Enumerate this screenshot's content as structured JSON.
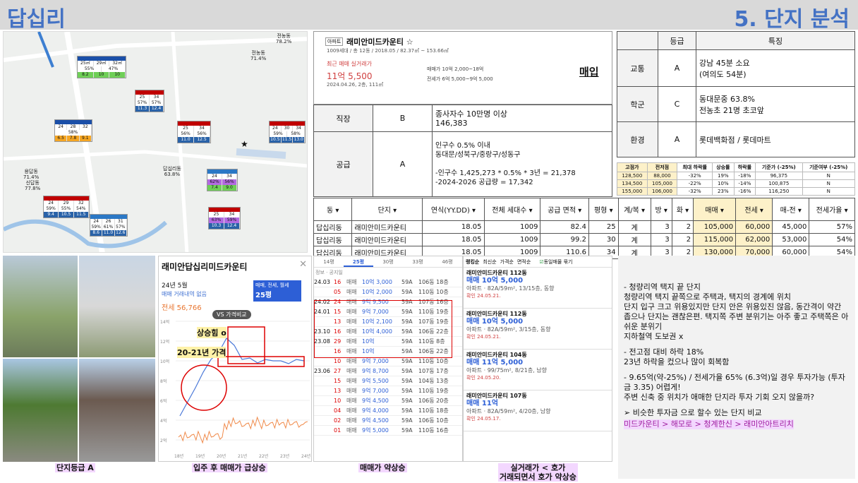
{
  "header": {
    "title_left": "답십리",
    "title_right": "5. 단지 분석"
  },
  "map": {
    "labels": [
      {
        "text": "전농동\n78.2%"
      },
      {
        "text": "전농동\n71.4%"
      },
      {
        "text": "용답동\n71.4%"
      },
      {
        "text": "신답동\n77.8%"
      },
      {
        "text": "답십리동\n63.8%"
      }
    ]
  },
  "info": {
    "tag": "아파트",
    "name": "래미안미드카운티 ☆",
    "sub": "1009세대 / 총 12동 / 2018.05 / 82.37㎡ ~ 153.66㎡",
    "recent_label": "최근 매매 실거래가",
    "recent_price": "11억 5,500",
    "recent_date": "2024.04.26, 2층, 111㎡",
    "sale_range": "매매가 10억 2,000~18억",
    "jeonse_range": "전세가 6억 5,000~9억 5,000",
    "trade_type": "매입"
  },
  "job_table": [
    {
      "k": "직장",
      "g": "B",
      "v": "종사자수 10만명 이상\n146,383"
    },
    {
      "k": "공급",
      "g": "A",
      "v": "인구수 0.5% 이내\n동대문/성북구/중랑구/성동구\n\n-인구수 1,425,273 * 0.5% * 3년 = 21,378\n-2024-2026 공급량 = 17,342"
    }
  ],
  "grade_table": {
    "headers": [
      "",
      "등급",
      "특징"
    ],
    "rows": [
      {
        "k": "교통",
        "g": "A",
        "v": "강남 45분 소요\n(여의도 54분)"
      },
      {
        "k": "학군",
        "g": "C",
        "v": "동대문중 63.8%\n전농초 21명 초코앞"
      },
      {
        "k": "환경",
        "g": "A",
        "v": "롯데백화점 / 롯데마트"
      }
    ]
  },
  "mini_table": {
    "headers": [
      "고점가",
      "전저점",
      "최대 하락률",
      "상승률",
      "하락률",
      "기준가 (-25%)",
      "기준여부 (-25%)"
    ],
    "rows": [
      [
        "128,500",
        "88,000",
        "-32%",
        "19%",
        "-18%",
        "96,375",
        "N"
      ],
      [
        "134,500",
        "105,000",
        "-22%",
        "10%",
        "-14%",
        "100,875",
        "N"
      ],
      [
        "155,000",
        "106,000",
        "-32%",
        "23%",
        "-16%",
        "116,250",
        "N"
      ]
    ]
  },
  "complex_table": {
    "headers": [
      "동",
      "단지",
      "연식(YY.DD)",
      "전체 세대수",
      "공급 면적",
      "평형",
      "계/복",
      "방",
      "화",
      "매매",
      "전세",
      "매-전",
      "전세가율"
    ],
    "rows": [
      [
        "답십리동",
        "래미안미드카운티",
        "18.05",
        "1009",
        "82.4",
        "25",
        "계",
        "3",
        "2",
        "105,000",
        "60,000",
        "45,000",
        "57%"
      ],
      [
        "답십리동",
        "래미안미드카운티",
        "18.05",
        "1009",
        "99.2",
        "30",
        "계",
        "3",
        "2",
        "115,000",
        "62,000",
        "53,000",
        "54%"
      ],
      [
        "답십리동",
        "래미안미드카운티",
        "18.05",
        "1009",
        "110.6",
        "34",
        "계",
        "3",
        "2",
        "130,000",
        "70,000",
        "60,000",
        "54%"
      ]
    ]
  },
  "captions": {
    "a": "단지등급 A",
    "b": "입주 후 매매가 급상승",
    "c": "매매가 약상승",
    "d": "실거래가 < 호가\n거래되면서 호가 약상승"
  },
  "chart_panel": {
    "title": "래미안답십리미드카운티",
    "period": "24년 5월",
    "no_deal": "매매 거래내역 없음",
    "jeonse": "전세 56,766",
    "filter": "매매, 전세, 월세",
    "size": "25평",
    "vs": "VS 가격비교",
    "ann1": "상승힘 o",
    "ann2": "20-21년 가격",
    "y_ticks": [
      "14억",
      "12억",
      "10억",
      "8억",
      "6억",
      "4억",
      "2억"
    ],
    "x_ticks": [
      "18년",
      "19년",
      "20년",
      "21년",
      "22년",
      "23년",
      "24년"
    ]
  },
  "deals": {
    "tabs": [
      "14평",
      "25평",
      "30평",
      "33평",
      "46평"
    ],
    "rows": [
      {
        "d": "24.03",
        "day": "16",
        "t": "매매",
        "p": "10억 3,000",
        "a": "59A",
        "f": "106동 18층"
      },
      {
        "d": "",
        "day": "05",
        "t": "매매",
        "p": "10억 2,000",
        "a": "59A",
        "f": "110동 10층"
      },
      {
        "d": "24.02",
        "day": "24",
        "t": "매매",
        "p": "9억 9,500",
        "a": "59A",
        "f": "107동 16층"
      },
      {
        "d": "24.01",
        "day": "15",
        "t": "매매",
        "p": "9억 7,000",
        "a": "59A",
        "f": "110동 19층"
      },
      {
        "d": "",
        "day": "13",
        "t": "매매",
        "p": "10억 2,100",
        "a": "59A",
        "f": "107동 19층"
      },
      {
        "d": "23.10",
        "day": "16",
        "t": "매매",
        "p": "10억 4,000",
        "a": "59A",
        "f": "106동 22층"
      },
      {
        "d": "23.08",
        "day": "29",
        "t": "매매",
        "p": "10억",
        "a": "59A",
        "f": "110동 8층"
      },
      {
        "d": "",
        "day": "16",
        "t": "매매",
        "p": "10억",
        "a": "59A",
        "f": "106동 22층"
      },
      {
        "d": "",
        "day": "10",
        "t": "매매",
        "p": "9억 7,000",
        "a": "59A",
        "f": "110동 10층"
      },
      {
        "d": "23.06",
        "day": "27",
        "t": "매매",
        "p": "9억 8,700",
        "a": "59A",
        "f": "107동 17층"
      },
      {
        "d": "",
        "day": "15",
        "t": "매매",
        "p": "9억 5,500",
        "a": "59A",
        "f": "104동 13층"
      },
      {
        "d": "",
        "day": "13",
        "t": "매매",
        "p": "9억 7,000",
        "a": "59A",
        "f": "110동 19층"
      },
      {
        "d": "",
        "day": "10",
        "t": "매매",
        "p": "9억 4,500",
        "a": "59A",
        "f": "106동 20층"
      },
      {
        "d": "",
        "day": "04",
        "t": "매매",
        "p": "9억 4,000",
        "a": "59A",
        "f": "110동 18층"
      },
      {
        "d": "",
        "day": "02",
        "t": "매매",
        "p": "9억 4,500",
        "a": "59A",
        "f": "106동 10층"
      },
      {
        "d": "",
        "day": "01",
        "t": "매매",
        "p": "9억 5,000",
        "a": "59A",
        "f": "110동 16층"
      }
    ]
  },
  "listings": {
    "tabs": [
      "랭킹순",
      "최신순",
      "가격순",
      "면적순"
    ],
    "same_label": "동일매물 묶기",
    "cards": [
      {
        "n": "래미안미드카운티 112동",
        "p": "매매 10억 5,000",
        "d": "아파트 · 82A/59m², 13/15층, 동향",
        "date": "확인 24.05.21."
      },
      {
        "n": "래미안미드카운티 112동",
        "p": "매매 10억 5,000",
        "d": "아파트 · 82A/59m², 3/15층, 동향",
        "date": "확인 24.05.21."
      },
      {
        "n": "래미안미드카운티 104동",
        "p": "매매 11억 5,000",
        "d": "아파트 · 99/75m², 8/21층, 남향",
        "date": "확인 24.05.20."
      },
      {
        "n": "래미안미드카운티 107동",
        "p": "매매 11억",
        "d": "아파트 · 82A/59m², 4/20층, 남향",
        "date": "확인 24.05.17."
      }
    ]
  },
  "notes": [
    "-   청량리역 택지 끝 단지",
    "청량리역 택지 끝쪽으로 주택과, 택지의 경계에 위치",
    "단지 입구 크고 위용있지만 단지 안은 위용있진 않음, 동간격이 약간 좁으나 단지는 괜찮은편. 택지쪽 주변 분위기는 아주 좋고 주택쪽은 아쉬운 분위기",
    "지하철역 도보권 x",
    "",
    "-   전고점 대비 하락 18%",
    "23년 하락을 컸으나 많이 회복함",
    "",
    "-   9.65억(약-25%) / 전세가율 65% (6.3억)일 경우 투자가능 (투자금 3.35) 어렵게!",
    "주변 신축 중 위치가 애매한 단지라 투자 기회 오지 않을까?",
    "",
    "➢  비슷한 투자금 으로 할수 있는 단지 비교"
  ],
  "notes_highlight": "미드카운티 > 해모로 > 청계한신 > 래미안아트리치",
  "colors": {
    "accent": "#4472c4",
    "caption_bg": "#f3d7ff",
    "highlight": "#c00000",
    "mini_header": "#fdf1c9"
  }
}
